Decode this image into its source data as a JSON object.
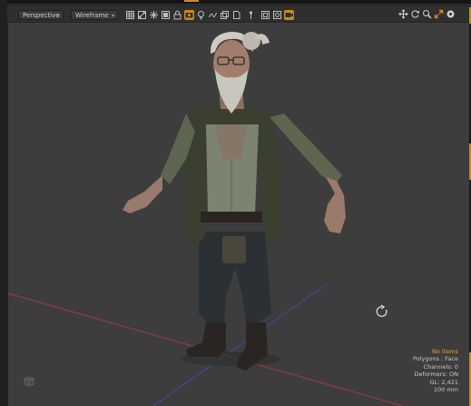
{
  "toolbar": {
    "view_dropdown": "Perspective",
    "shading_dropdown": "Wireframe",
    "buttons": [
      {
        "icon": "grid-icon"
      },
      {
        "icon": "bone-icon"
      },
      {
        "icon": "star-burst-icon"
      },
      {
        "icon": "cube-icon"
      },
      {
        "icon": "camera-icon",
        "active": true
      },
      {
        "icon": "light-bulb-icon"
      },
      {
        "icon": "deformer-icon"
      },
      {
        "icon": "layers-icon"
      },
      {
        "icon": "pin-icon"
      },
      {
        "icon": "frame-icon"
      },
      {
        "icon": "texture-icon"
      },
      {
        "icon": "video-camera-icon",
        "active": true
      }
    ]
  },
  "hud_icons": [
    "move-icon",
    "rotate-icon",
    "zoom-icon",
    "maximize-icon",
    "options-icon"
  ],
  "colors": {
    "accent": "#c98a1d",
    "viewport_bg": "#3d3d3d",
    "warning_text": "#e0a03a",
    "x_axis": "#b83a3a",
    "z_axis": "#3a4fbf"
  },
  "info_overlay": {
    "no_items": "No items",
    "polygons": "Polygons : Face",
    "channels": "Channels: 0",
    "deformers": "Deformers: ON",
    "gl": "GL: 2,421",
    "scale": "100 mm"
  }
}
